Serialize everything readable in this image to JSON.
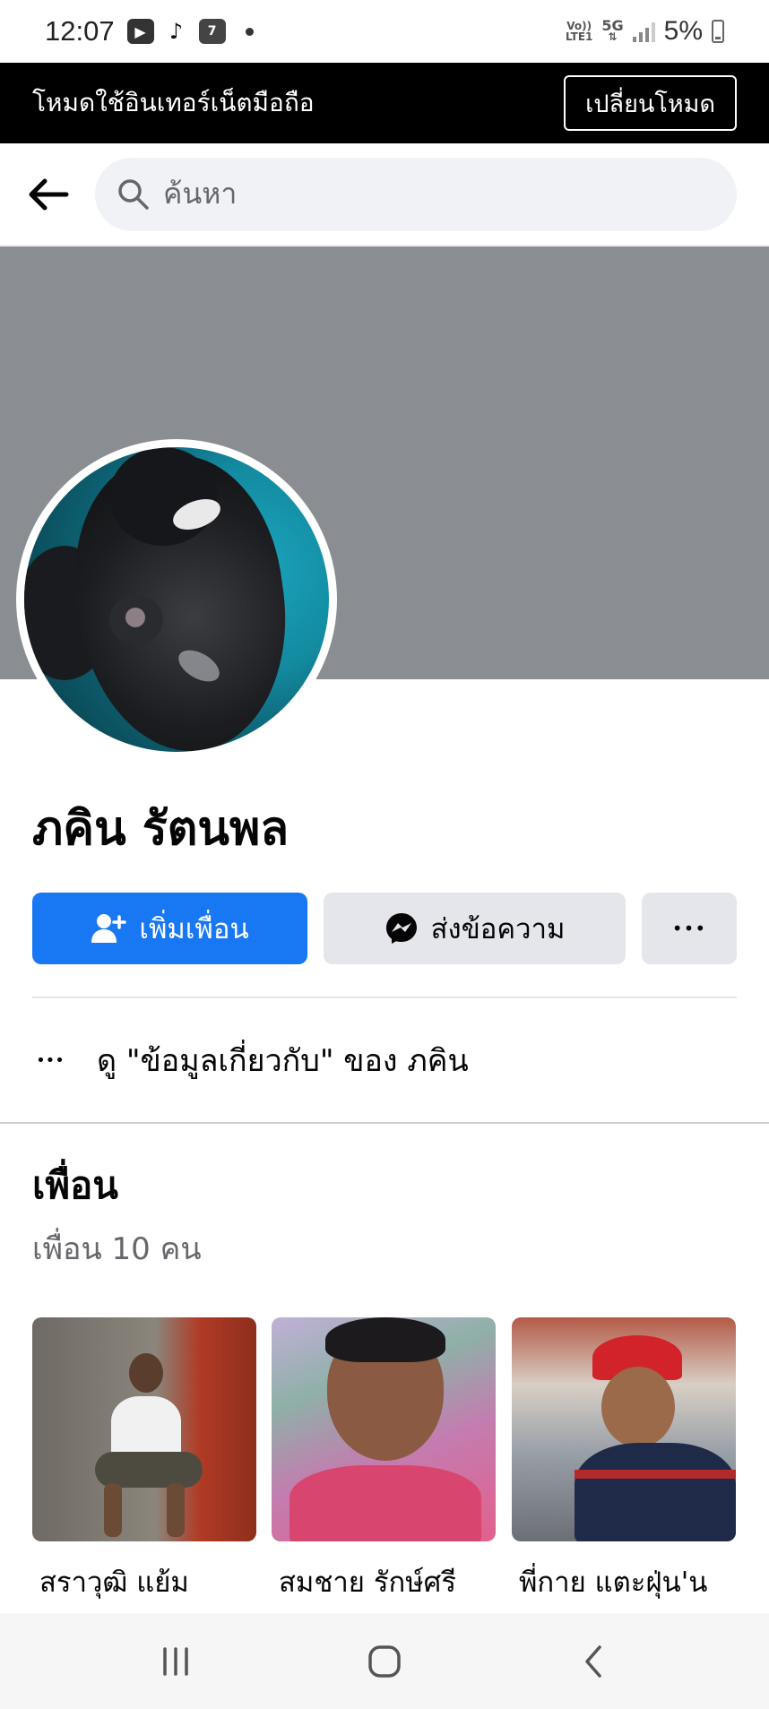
{
  "status_bar": {
    "time": "12:07",
    "network_top": "Vo))",
    "network_bottom": "LTE1",
    "network_5g": "5G",
    "battery": "5%",
    "seven_eleven": "7"
  },
  "banner": {
    "text": "โหมดใช้อินเทอร์เน็ตมือถือ",
    "button_label": "เปลี่ยนโหมด"
  },
  "search": {
    "placeholder": "ค้นหา"
  },
  "profile": {
    "name": "ภคิน รัตนพล",
    "add_friend_label": "เพิ่มเพื่อน",
    "message_label": "ส่งข้อความ",
    "more_label": "•••",
    "about_dots": "•••",
    "about_text": "ดู \"ข้อมูลเกี่ยวกับ\" ของ ภคิน"
  },
  "friends": {
    "title": "เพื่อน",
    "count_text": "เพื่อน 10 คน",
    "items": [
      {
        "name": "สราวุฒิ แย้ม"
      },
      {
        "name": "สมชาย รักษ์ศรี"
      },
      {
        "name": "พี่กาย แตะฝุ่น'น"
      }
    ]
  },
  "colors": {
    "accent": "#1877f2",
    "cover": "#8a8d91",
    "button_gray": "#e4e6eb"
  },
  "icons": {
    "back": "arrow-left-icon",
    "search": "search-icon",
    "add_friend": "person-add-icon",
    "messenger": "messenger-icon",
    "nav_recents": "recents-icon",
    "nav_home": "home-icon",
    "nav_back": "back-icon"
  }
}
